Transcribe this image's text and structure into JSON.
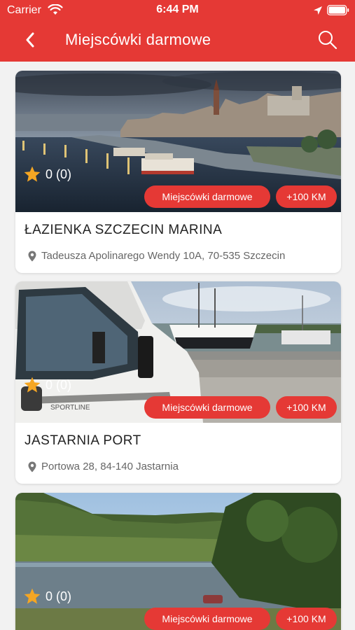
{
  "status_bar": {
    "carrier": "Carrier",
    "time": "6:44 PM"
  },
  "header": {
    "title": "Miejscówki darmowe",
    "back_icon": "chevron-left-icon",
    "search_icon": "search-icon"
  },
  "colors": {
    "accent": "#e53935",
    "star": "#f5a623",
    "background": "#f2f2f2"
  },
  "cards": [
    {
      "rating": "0 (0)",
      "category": "Miejscówki darmowe",
      "distance": "+100 KM",
      "name": "ŁAZIENKA SZCZECIN MARINA",
      "address": "Tadeusza Apolinarego Wendy 10A, 70-535 Szczecin"
    },
    {
      "rating": "0 (0)",
      "category": "Miejscówki darmowe",
      "distance": "+100 KM",
      "name": "JASTARNIA PORT",
      "address": "Portowa 28, 84-140 Jastarnia"
    },
    {
      "rating": "0 (0)",
      "category": "Miejscówki darmowe",
      "distance": "+100 KM"
    }
  ]
}
